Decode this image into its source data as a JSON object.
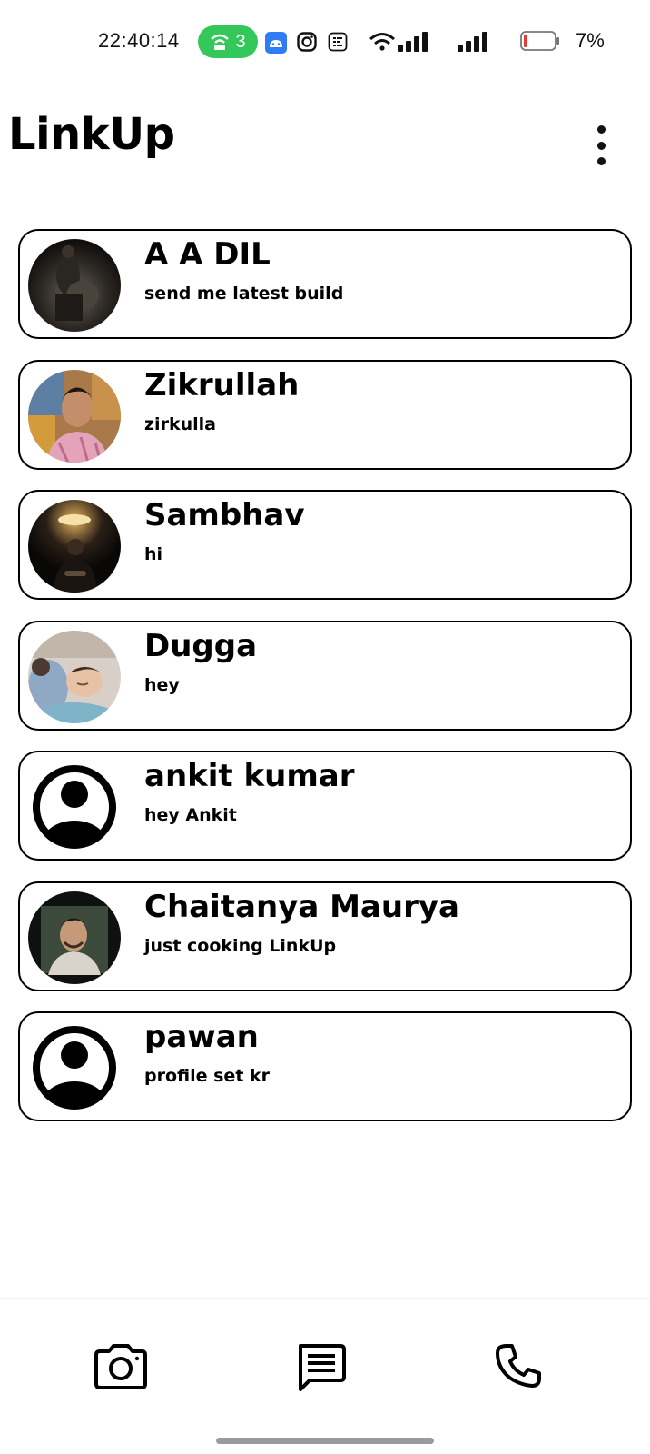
{
  "status_bar": {
    "time": "22:40:14",
    "hotspot_count": "3",
    "battery_percent": "7%",
    "icons": [
      "hotspot-icon",
      "android-icon",
      "instagram-icon",
      "sim-toolkit-icon",
      "wifi-icon",
      "signal-icon",
      "signal-icon",
      "battery-icon"
    ],
    "hotspot_color": "#34c759",
    "battery_low_color": "#e53935"
  },
  "header": {
    "title": "LinkUp"
  },
  "chats": [
    {
      "name": "A A DIL",
      "last_message": "send me latest build",
      "avatar": "photo"
    },
    {
      "name": "Zikrullah",
      "last_message": "zirkulla",
      "avatar": "photo"
    },
    {
      "name": "Sambhav",
      "last_message": "hi",
      "avatar": "photo"
    },
    {
      "name": "Dugga",
      "last_message": "hey",
      "avatar": "photo"
    },
    {
      "name": "ankit kumar",
      "last_message": "hey Ankit",
      "avatar": "default-user-icon"
    },
    {
      "name": "Chaitanya Maurya",
      "last_message": "just cooking LinkUp",
      "avatar": "photo"
    },
    {
      "name": "pawan",
      "last_message": "profile set kr",
      "avatar": "default-user-icon"
    }
  ],
  "bottom_nav": {
    "items": [
      "camera-icon",
      "chat-icon",
      "phone-icon"
    ]
  }
}
